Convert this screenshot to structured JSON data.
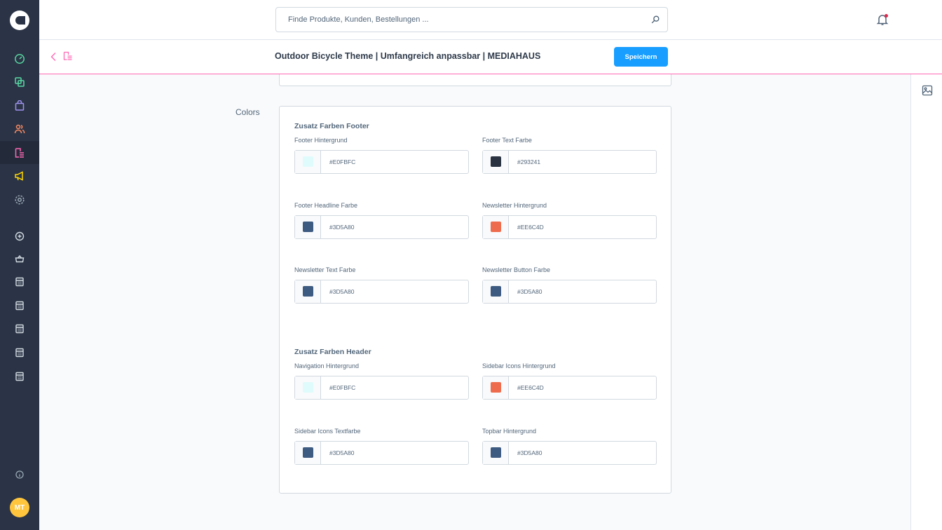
{
  "app": {
    "logo_icon": "shopware-logo-icon"
  },
  "sidebar": {
    "items": [
      {
        "name": "dashboard-icon",
        "color": "#57d9a3"
      },
      {
        "name": "catalog-icon",
        "color": "#57d9a3"
      },
      {
        "name": "orders-icon",
        "color": "#a092f0"
      },
      {
        "name": "customers-icon",
        "color": "#f88962"
      },
      {
        "name": "content-icon",
        "color": "#ff68b4"
      },
      {
        "name": "marketing-icon",
        "color": "#ffd700"
      },
      {
        "name": "settings-icon",
        "color": "#9aa8b5"
      }
    ],
    "plugins": [
      {
        "name": "add-circle-icon"
      },
      {
        "name": "basket-icon"
      },
      {
        "name": "calculator-icon"
      },
      {
        "name": "calculator-icon"
      },
      {
        "name": "calculator-icon"
      },
      {
        "name": "calculator-icon"
      },
      {
        "name": "calculator-icon"
      }
    ],
    "help_icon": "info-icon",
    "avatar_initials": "MT"
  },
  "header": {
    "search_placeholder": "Finde Produkte, Kunden, Bestellungen ...",
    "notification_icon": "bell-icon"
  },
  "smartbar": {
    "title": "Outdoor Bicycle Theme | Umfangreich anpassbar | MEDIAHAUS",
    "save_label": "Speichern"
  },
  "content": {
    "section_label": "Colors",
    "groups": [
      {
        "title": "Zusatz Farben Footer",
        "fields": [
          {
            "label": "Footer Hintergrund",
            "value": "#E0FBFC",
            "color": "#E0FBFC"
          },
          {
            "label": "Footer Text Farbe",
            "value": "#293241",
            "color": "#293241"
          },
          {
            "label": "Footer Headline Farbe",
            "value": "#3D5A80",
            "color": "#3D5A80"
          },
          {
            "label": "Newsletter Hintergrund",
            "value": "#EE6C4D",
            "color": "#EE6C4D"
          },
          {
            "label": "Newsletter Text Farbe",
            "value": "#3D5A80",
            "color": "#3D5A80"
          },
          {
            "label": "Newsletter Button Farbe",
            "value": "#3D5A80",
            "color": "#3D5A80"
          }
        ]
      },
      {
        "title": "Zusatz Farben Header",
        "fields": [
          {
            "label": "Navigation Hintergrund",
            "value": "#E0FBFC",
            "color": "#E0FBFC"
          },
          {
            "label": "Sidebar Icons Hintergrund",
            "value": "#EE6C4D",
            "color": "#EE6C4D"
          },
          {
            "label": "Sidebar Icons Textfarbe",
            "value": "#3D5A80",
            "color": "#3D5A80"
          },
          {
            "label": "Topbar Hintergrund",
            "value": "#3D5A80",
            "color": "#3D5A80"
          }
        ]
      }
    ]
  }
}
